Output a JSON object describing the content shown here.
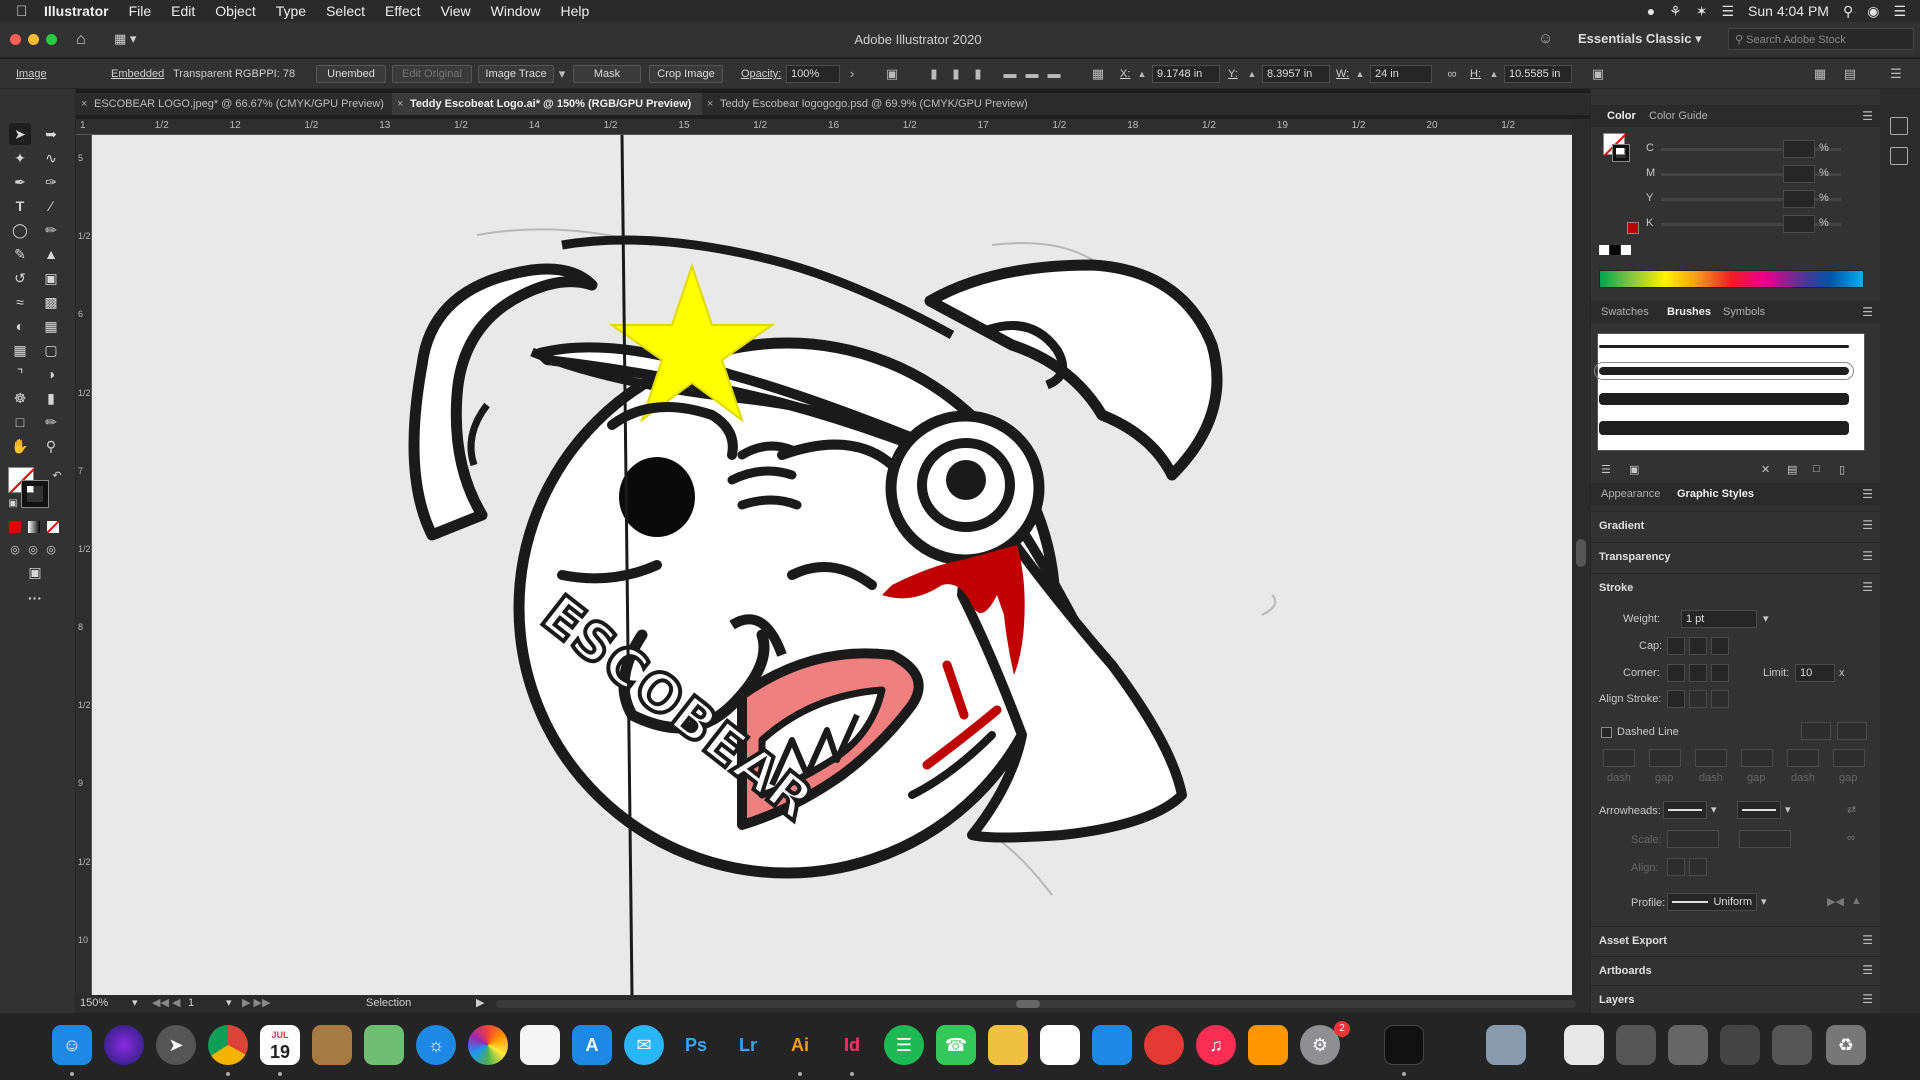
{
  "menubar": {
    "app": "Illustrator",
    "items": [
      "File",
      "Edit",
      "Object",
      "Type",
      "Select",
      "Effect",
      "View",
      "Window",
      "Help"
    ],
    "clock": "Sun 4:04 PM"
  },
  "titlebar": {
    "title": "Adobe Illustrator 2020",
    "workspace": "Essentials Classic",
    "search_placeholder": "Search Adobe Stock"
  },
  "controlbar": {
    "selection_type": "Image",
    "embedded": "Embedded",
    "color_info": "Transparent RGB",
    "ppi": "PPI: 78",
    "unembed": "Unembed",
    "edit_original": "Edit Original",
    "image_trace": "Image Trace",
    "mask": "Mask",
    "crop_image": "Crop Image",
    "opacity_label": "Opacity:",
    "opacity_value": "100%",
    "x_label": "X:",
    "x_value": "9.1748 in",
    "y_label": "Y:",
    "y_value": "8.3957 in",
    "w_label": "W:",
    "w_value": "24 in",
    "h_label": "H:",
    "h_value": "10.5585 in"
  },
  "tabs": [
    {
      "label": "ESCOBEAR LOGO.jpeg* @ 66.67% (CMYK/GPU Preview)"
    },
    {
      "label": "Teddy Escobeat Logo.ai* @ 150% (RGB/GPU Preview)"
    },
    {
      "label": "Teddy Escobear logogogo.psd @ 69.9% (CMYK/GPU Preview)"
    }
  ],
  "ruler": {
    "h_labels": [
      "1",
      "1/2",
      "12",
      "1/2",
      "13",
      "1/2",
      "14",
      "1/2",
      "15",
      "1/2",
      "16",
      "1/2",
      "17",
      "1/2",
      "18",
      "1/2",
      "19",
      "1/2",
      "20",
      "1/2"
    ],
    "v_labels": [
      "5",
      "1/2",
      "6",
      "1/2",
      "7",
      "1/2",
      "8",
      "1/2",
      "9",
      "1/2",
      "10"
    ]
  },
  "artwork": {
    "logo_text": "ESCOBEAR"
  },
  "statusbar": {
    "zoom": "150%",
    "artboard": "1",
    "tool": "Selection"
  },
  "color_panel": {
    "tabs": [
      "Color",
      "Color Guide"
    ],
    "channels": [
      "C",
      "M",
      "Y",
      "K"
    ],
    "pct": "%"
  },
  "swatch_tabs": [
    "Swatches",
    "Brushes",
    "Symbols"
  ],
  "appearance_tabs": [
    "Appearance",
    "Graphic Styles"
  ],
  "sections": {
    "gradient": "Gradient",
    "transparency": "Transparency",
    "stroke": "Stroke",
    "asset_export": "Asset Export",
    "artboards": "Artboards",
    "layers": "Layers"
  },
  "stroke": {
    "weight_label": "Weight:",
    "weight_value": "1 pt",
    "cap_label": "Cap:",
    "corner_label": "Corner:",
    "limit_label": "Limit:",
    "limit_value": "10",
    "limit_unit": "x",
    "align_label": "Align Stroke:",
    "dashed_label": "Dashed Line",
    "dash_labels": [
      "dash",
      "gap",
      "dash",
      "gap",
      "dash",
      "gap"
    ],
    "arrowheads_label": "Arrowheads:",
    "scale_label": "Scale:",
    "align_arrow_label": "Align:",
    "profile_label": "Profile:",
    "profile_value": "Uniform"
  },
  "dock": {
    "apps": [
      {
        "label": "Ps",
        "color": "#001e36",
        "fg": "#31a8ff"
      },
      {
        "label": "Lr",
        "color": "#001e36",
        "fg": "#31a8ff"
      },
      {
        "label": "Ai",
        "color": "#330000",
        "fg": "#ff9a00"
      },
      {
        "label": "Id",
        "color": "#49021f",
        "fg": "#ff3366"
      }
    ],
    "calendar_month": "JUL",
    "calendar_day": "19",
    "badge": "2"
  },
  "colors": {
    "yellow_star": "#ffff00",
    "blood_red": "#c00000",
    "mouth_pink": "#f08080",
    "ink": "#1a1a1a"
  }
}
